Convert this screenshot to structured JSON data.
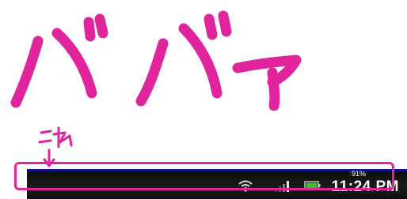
{
  "status_bar": {
    "time": "11:24 PM",
    "battery_percent": "91%",
    "icons": [
      "wifi-icon",
      "signal-bars-icon",
      "battery-icon"
    ]
  },
  "colors": {
    "annotation": "#e0249c",
    "status_bar_bg": "#111111",
    "status_bar_top_line": "#12128a"
  }
}
